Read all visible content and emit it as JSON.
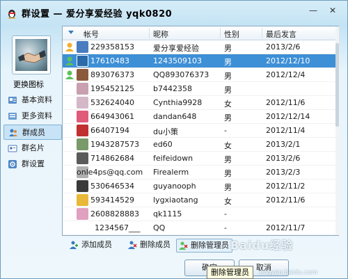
{
  "window": {
    "title": "群设置 — 爱分享爱经验 yqk0820",
    "minimize_glyph": "—",
    "close_glyph": "✕"
  },
  "sidebar": {
    "change_icon_label": "更换图标",
    "items": [
      {
        "label": "基本资料",
        "icon": "profile-card-icon",
        "active": false
      },
      {
        "label": "更多资料",
        "icon": "more-info-icon",
        "active": false
      },
      {
        "label": "群成员",
        "icon": "members-icon",
        "active": true
      },
      {
        "label": "群名片",
        "icon": "name-card-icon",
        "active": false
      },
      {
        "label": "群设置",
        "icon": "settings-icon",
        "active": false
      }
    ]
  },
  "table": {
    "columns": [
      "帐号",
      "昵称",
      "性别",
      "最后发言"
    ],
    "rows": [
      {
        "role": "owner",
        "account": "229358153",
        "nickname": "爱分享爱经验",
        "gender": "男",
        "last": "2013/2/6",
        "color": "#4a7cc0"
      },
      {
        "role": "admin",
        "account": "17610483",
        "nickname": "1243509103",
        "gender": "男",
        "last": "2012/12/10",
        "color": "#2a6aa8",
        "selected": true
      },
      {
        "role": "admin",
        "account": "893076373",
        "nickname": "QQ893076373",
        "gender": "男",
        "last": "2012/12/4",
        "color": "#8b5a3c"
      },
      {
        "role": "",
        "account": "195452125",
        "nickname": "b7442358",
        "gender": "男",
        "last": "",
        "color": "#c8a0b0"
      },
      {
        "role": "",
        "account": "532624040",
        "nickname": "Cynthia9928",
        "gender": "女",
        "last": "2012/11/6",
        "color": "#d4b8c8"
      },
      {
        "role": "",
        "account": "664943061",
        "nickname": "dandan648",
        "gender": "男",
        "last": "2012/12/14",
        "color": "#e05a7a"
      },
      {
        "role": "",
        "account": "66407194",
        "nickname": "du小策",
        "gender": "-",
        "last": "2012/11/4",
        "color": "#c03030"
      },
      {
        "role": "",
        "account": "1943287573",
        "nickname": "ed60",
        "gender": "女",
        "last": "2013/2/1",
        "color": "#7a9a6a"
      },
      {
        "role": "",
        "account": "714862684",
        "nickname": "feifeidown",
        "gender": "男",
        "last": "2013/2/6",
        "color": "#5a5a5a"
      },
      {
        "role": "",
        "account": "onle4ps@qq.com",
        "nickname": "Firealerm",
        "gender": "男",
        "last": "2013/2/3",
        "color": "#b0b0b0"
      },
      {
        "role": "",
        "account": "530646534",
        "nickname": "guyanooph",
        "gender": "男",
        "last": "2012/11/2",
        "color": "#3a3a3a"
      },
      {
        "role": "",
        "account": "593414529",
        "nickname": "lygxiaotang",
        "gender": "女",
        "last": "2012/11/6",
        "color": "#e8b838"
      },
      {
        "role": "",
        "account": "2608828883",
        "nickname": "qk1115",
        "gender": "-",
        "last": "",
        "color": "#e0a0c0"
      },
      {
        "role": "",
        "account": "1234567___",
        "nickname": "QQ",
        "gender": "-",
        "last": "2012/11/7",
        "color": ""
      }
    ]
  },
  "toolbar": {
    "add_member": "添加成员",
    "remove_member": "删除成员",
    "remove_admin": "删除管理员"
  },
  "buttons": {
    "ok": "确定",
    "cancel": "取消"
  },
  "tooltip": "删除管理员",
  "watermark": {
    "logo": "Baidu经验",
    "url": "jingyan.baidu.com"
  },
  "colors": {
    "selection": "#3d8fd6",
    "accent": "#4a90c8"
  }
}
